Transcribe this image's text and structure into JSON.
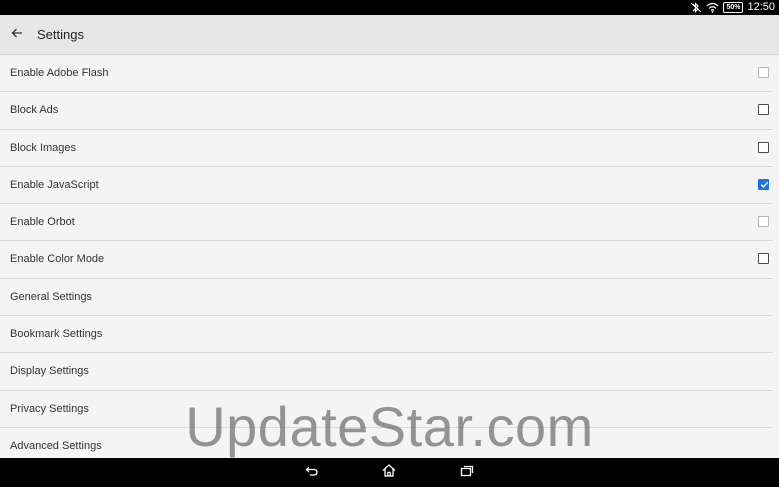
{
  "status_bar": {
    "time": "12:50",
    "battery": "50%"
  },
  "app_bar": {
    "title": "Settings"
  },
  "settings": [
    {
      "label": "Enable Adobe Flash",
      "checkbox": true,
      "checked": false,
      "enabled": false
    },
    {
      "label": "Block Ads",
      "checkbox": true,
      "checked": false,
      "enabled": true
    },
    {
      "label": "Block Images",
      "checkbox": true,
      "checked": false,
      "enabled": true
    },
    {
      "label": "Enable JavaScript",
      "checkbox": true,
      "checked": true,
      "enabled": true
    },
    {
      "label": "Enable Orbot",
      "checkbox": true,
      "checked": false,
      "enabled": false
    },
    {
      "label": "Enable Color Mode",
      "checkbox": true,
      "checked": false,
      "enabled": true
    },
    {
      "label": "General Settings",
      "checkbox": false
    },
    {
      "label": "Bookmark Settings",
      "checkbox": false
    },
    {
      "label": "Display Settings",
      "checkbox": false
    },
    {
      "label": "Privacy Settings",
      "checkbox": false
    },
    {
      "label": "Advanced Settings",
      "checkbox": false
    }
  ],
  "watermark": "UpdateStar.com",
  "colors": {
    "accent": "#1e73d6",
    "appbar": "#e6e6e6",
    "background": "#f4f4f4"
  }
}
